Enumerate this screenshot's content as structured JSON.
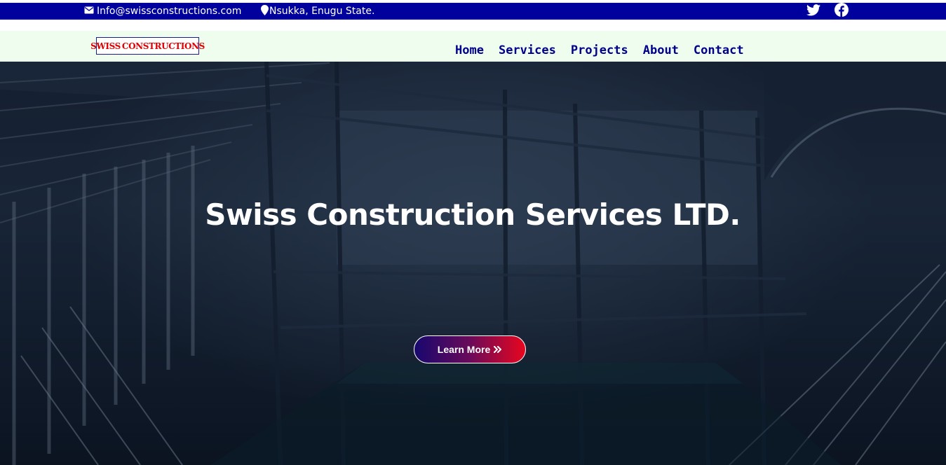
{
  "topbar": {
    "email": "Info@swissconstructions.com",
    "location": "Nsukka, Enugu State.",
    "icons": [
      "envelope-icon",
      "map-pin-icon",
      "twitter-icon",
      "facebook-icon"
    ]
  },
  "logo": {
    "left_text": "SWISS",
    "right_text": "CONSTRUCTIONS"
  },
  "nav": {
    "items": [
      "Home",
      "Services",
      "Projects",
      "About",
      "Contact"
    ]
  },
  "hero": {
    "title": "Swiss Construction Services LTD.",
    "button_label": "Learn More"
  },
  "colors": {
    "topbar_bg": "#00009c",
    "navbar_bg": "#eefdee",
    "nav_link": "#00008b",
    "logo_red": "#e00000",
    "button_gradient_start": "#17086e",
    "button_gradient_end": "#e8061e"
  }
}
